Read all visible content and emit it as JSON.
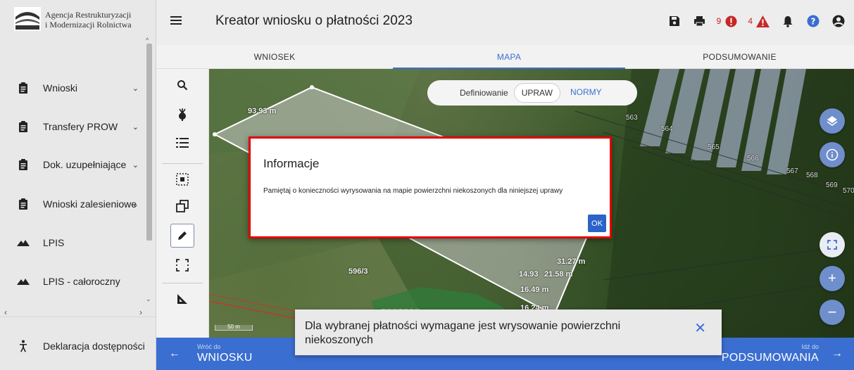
{
  "logo": {
    "line1": "Agencja Restrukturyzacji",
    "line2": "i Modernizacji Rolnictwa",
    "mark_text": "ARiMR"
  },
  "sidebar": {
    "items": [
      {
        "label": "Wnioski",
        "icon": "clipboard-icon",
        "chevron": "⌄"
      },
      {
        "label": "Transfery PROW",
        "icon": "clipboard-icon",
        "chevron": "⌄"
      },
      {
        "label": "Dok. uzupełniające",
        "icon": "clipboard-icon",
        "chevron": "⌄"
      },
      {
        "label": "Wnioski zalesieniowe",
        "icon": "clipboard-icon",
        "chevron": "⌄"
      },
      {
        "label": "LPIS",
        "icon": "terrain-icon"
      },
      {
        "label": "LPIS - całoroczny",
        "icon": "terrain-icon"
      }
    ],
    "footer": {
      "label": "Deklaracja dostępności",
      "icon": "accessibility-icon"
    }
  },
  "header": {
    "title": "Kreator wniosku o płatności 2023",
    "error_count": "9",
    "warning_count": "4",
    "colors": {
      "error": "#d11c1c",
      "warning": "#c62828",
      "accent": "#3a6ed1"
    }
  },
  "tabs": [
    {
      "label": "WNIOSEK",
      "active": false
    },
    {
      "label": "MAPA",
      "active": true
    },
    {
      "label": "PODSUMOWANIE",
      "active": false
    }
  ],
  "map": {
    "definition_label": "Definiowanie",
    "option_selected": "UPRAW",
    "option_alt": "NORMY",
    "labels": {
      "measure1": "93.93 m",
      "measure2": "31.27 m",
      "measure3": "14.93",
      "measure4": "21.58 m",
      "measure5": "16.49 m",
      "measure6": "16.24 m",
      "parcel": "596/3",
      "p563": "563",
      "p564": "564",
      "p565": "565",
      "p566": "566",
      "p567": "567",
      "p568": "568",
      "p569": "569",
      "p570": "570"
    },
    "scale": "50 m"
  },
  "dialog": {
    "title": "Informacje",
    "text": "Pamiętaj o konieczności wyrysowania na mapie powierzchni niekoszonych dla niniejszej uprawy",
    "ok_label": "OK"
  },
  "bottom": {
    "back_small": "Wróć do",
    "back_big": "WNIOSKU",
    "next_small": "Idź do",
    "next_big": "PODSUMOWANIA"
  },
  "snackbar": {
    "text": "Dla wybranej płatności wymagane jest wrysowanie powierzchni niekoszonych",
    "close": "✕"
  }
}
